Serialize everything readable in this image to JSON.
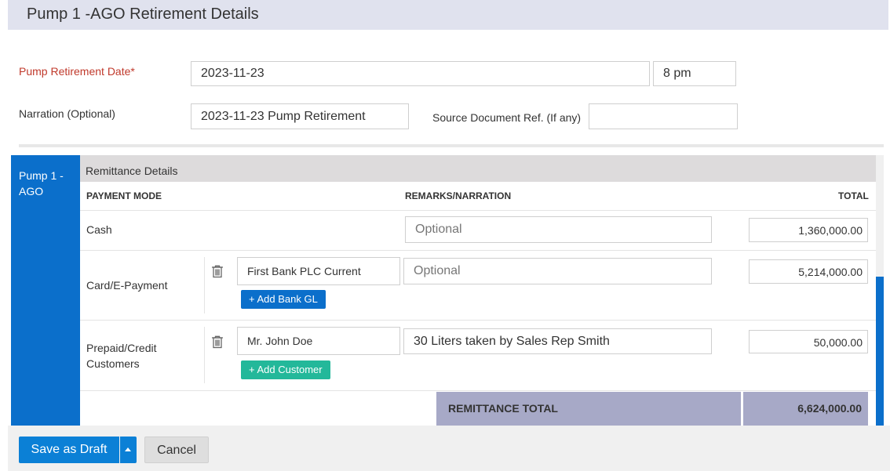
{
  "header": {
    "title": "Pump 1 -AGO Retirement Details"
  },
  "form": {
    "retirement_date_label": "Pump Retirement Date*",
    "retirement_date_value": "2023-11-23",
    "retirement_time_value": "8 pm",
    "narration_label": "Narration (Optional)",
    "narration_value": "2023-11-23 Pump Retirement",
    "source_doc_label": "Source Document Ref. (If any)",
    "source_doc_value": ""
  },
  "pump_tab": {
    "label": "Pump 1 - AGO"
  },
  "remittance": {
    "section_title": "Remittance Details",
    "columns": {
      "payment_mode": "PAYMENT MODE",
      "remarks": "REMARKS/NARRATION",
      "total": "TOTAL"
    },
    "rows": [
      {
        "mode": "Cash",
        "remarks_placeholder": "Optional",
        "remarks_value": "",
        "total": "1,360,000.00"
      },
      {
        "mode": "Card/E-Payment",
        "account": "First Bank PLC Current",
        "add_button": "+ Add Bank GL",
        "remarks_placeholder": "Optional",
        "remarks_value": "",
        "total": "5,214,000.00"
      },
      {
        "mode": "Prepaid/Credit Customers",
        "account": "Mr. John Doe",
        "add_button": "+ Add Customer",
        "remarks_placeholder": "",
        "remarks_value": "30  Liters taken by Sales Rep Smith",
        "total": "50,000.00"
      }
    ],
    "total_label": "REMITTANCE TOTAL",
    "total_value": "6,624,000.00"
  },
  "footer": {
    "save_label": "Save as Draft",
    "cancel_label": "Cancel"
  },
  "colors": {
    "primary": "#0b6fcb",
    "teal": "#23b89a",
    "required": "#c0392b",
    "total_bg": "#a7a9c7"
  },
  "icons": {
    "delete": "trash-icon",
    "dropdown": "caret-up-icon"
  }
}
